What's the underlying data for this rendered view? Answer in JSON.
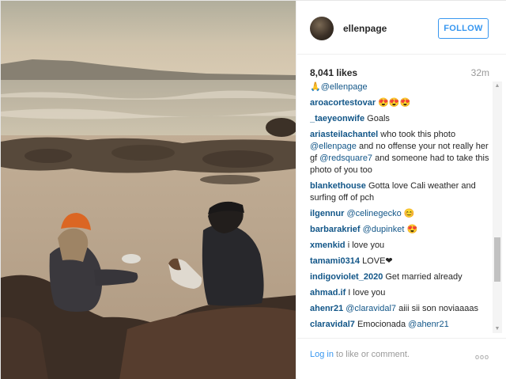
{
  "post": {
    "username": "ellenpage",
    "follow_label": "FOLLOW",
    "likes": "8,041 likes",
    "time": "32m"
  },
  "comments": [
    {
      "user": "",
      "parts": [
        {
          "t": "mention",
          "v": "🙏@ellenpage"
        }
      ]
    },
    {
      "user": "aroacortestovar",
      "parts": [
        {
          "t": "text",
          "v": "😍😍😍"
        }
      ]
    },
    {
      "user": "_taeyeonwife",
      "parts": [
        {
          "t": "text",
          "v": "Goals"
        }
      ]
    },
    {
      "user": "ariasteilachantel",
      "parts": [
        {
          "t": "text",
          "v": "who took this photo "
        },
        {
          "t": "mention",
          "v": "@ellenpage"
        },
        {
          "t": "text",
          "v": " and no offense your not really her gf "
        },
        {
          "t": "mention",
          "v": "@redsquare7"
        },
        {
          "t": "text",
          "v": " and someone had to take this photo of you too"
        }
      ]
    },
    {
      "user": "blankethouse",
      "parts": [
        {
          "t": "text",
          "v": "Gotta love Cali weather and surfing off of pch"
        }
      ]
    },
    {
      "user": "ilgennur",
      "parts": [
        {
          "t": "mention",
          "v": "@celinegecko"
        },
        {
          "t": "text",
          "v": " 😊"
        }
      ]
    },
    {
      "user": "barbarakrief",
      "parts": [
        {
          "t": "mention",
          "v": "@dupinket"
        },
        {
          "t": "text",
          "v": " 😍"
        }
      ]
    },
    {
      "user": "xmenkid",
      "parts": [
        {
          "t": "text",
          "v": "i love you"
        }
      ]
    },
    {
      "user": "tamami0314",
      "parts": [
        {
          "t": "text",
          "v": "LOVE❤"
        }
      ]
    },
    {
      "user": "indigoviolet_2020",
      "parts": [
        {
          "t": "text",
          "v": "Get married already"
        }
      ]
    },
    {
      "user": "ahmad.if",
      "parts": [
        {
          "t": "text",
          "v": "I love you"
        }
      ]
    },
    {
      "user": "ahenr21",
      "parts": [
        {
          "t": "mention",
          "v": "@claravidal7"
        },
        {
          "t": "text",
          "v": " aiii sii son noviaaaas"
        }
      ]
    },
    {
      "user": "claravidal7",
      "parts": [
        {
          "t": "text",
          "v": "Emocionada "
        },
        {
          "t": "mention",
          "v": "@ahenr21"
        }
      ]
    }
  ],
  "footer": {
    "login_link": "Log in",
    "login_rest": " to like or comment.",
    "more": "ooo"
  },
  "colors": {
    "accent": "#3897f0",
    "username": "#125688",
    "muted": "#999999"
  }
}
